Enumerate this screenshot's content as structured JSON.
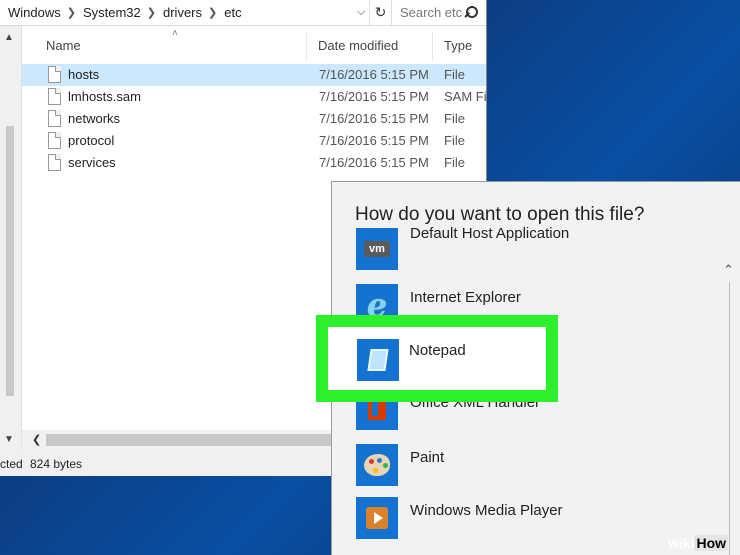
{
  "explorer": {
    "breadcrumbs": [
      "Windows",
      "System32",
      "drivers",
      "etc"
    ],
    "search_placeholder": "Search etc",
    "columns": {
      "name": "Name",
      "date": "Date modified",
      "type": "Type"
    },
    "files": [
      {
        "name": "hosts",
        "date": "7/16/2016 5:15 PM",
        "type": "File",
        "selected": true
      },
      {
        "name": "lmhosts.sam",
        "date": "7/16/2016 5:15 PM",
        "type": "SAM File",
        "selected": false
      },
      {
        "name": "networks",
        "date": "7/16/2016 5:15 PM",
        "type": "File",
        "selected": false
      },
      {
        "name": "protocol",
        "date": "7/16/2016 5:15 PM",
        "type": "File",
        "selected": false
      },
      {
        "name": "services",
        "date": "7/16/2016 5:15 PM",
        "type": "File",
        "selected": false
      }
    ],
    "status": {
      "selected_text": "cted",
      "size": "824 bytes"
    }
  },
  "open_with": {
    "title": "How do you want to open this file?",
    "apps": [
      {
        "name": "Default Host Application",
        "icon": "vm-icon",
        "badge": "vm"
      },
      {
        "name": "Internet Explorer",
        "icon": "internet-explorer-icon",
        "glyph": "e"
      },
      {
        "name": "Notepad",
        "icon": "notepad-icon",
        "highlighted": true
      },
      {
        "name": "Office XML Handler",
        "icon": "office-icon"
      },
      {
        "name": "Paint",
        "icon": "paint-icon"
      },
      {
        "name": "Windows Media Player",
        "icon": "media-player-icon"
      }
    ]
  },
  "colors": {
    "highlight": "#2cf02c",
    "tile_blue": "#1473d0",
    "selection": "#cce8ff"
  },
  "watermark": {
    "part1": "wiki",
    "part2": "How"
  }
}
